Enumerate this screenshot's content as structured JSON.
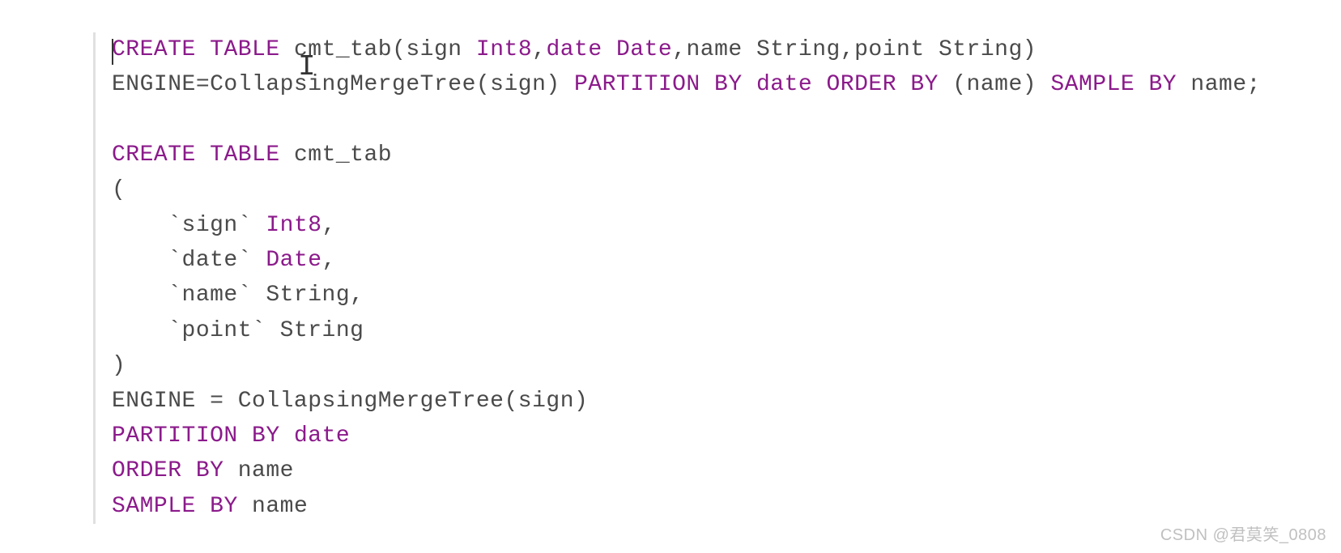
{
  "code": {
    "line1": {
      "kw_create": "CREATE",
      "kw_table": "TABLE",
      "name": " cmt_tab(sign ",
      "type_int8": "Int8",
      "comma1": ",",
      "kw_date": "date",
      "space1": " ",
      "type_date": "Date",
      "rest1": ",name String,point String)"
    },
    "line2": {
      "engine": "ENGINE=CollapsingMergeTree(sign) ",
      "kw_partition": "PARTITION",
      "space1": " ",
      "kw_by1": "BY",
      "space2": " ",
      "kw_date": "date",
      "space3": " ",
      "kw_order": "ORDER",
      "space4": " ",
      "kw_by2": "BY",
      "rest1": " (name) ",
      "kw_sample": "SAMPLE",
      "space5": " ",
      "kw_by3": "BY",
      "rest2": " name;"
    },
    "line4": {
      "kw_create": "CREATE",
      "space1": " ",
      "kw_table": "TABLE",
      "name": " cmt_tab"
    },
    "line5": {
      "paren": "("
    },
    "line6": {
      "text1": "    `sign` ",
      "type": "Int8",
      "text2": ","
    },
    "line7": {
      "text1": "    `date` ",
      "type": "Date",
      "text2": ","
    },
    "line8": {
      "text": "    `name` String,"
    },
    "line9": {
      "text": "    `point` String"
    },
    "line10": {
      "paren": ")"
    },
    "line11": {
      "text": "ENGINE = CollapsingMergeTree(sign)"
    },
    "line12": {
      "kw_partition": "PARTITION",
      "space1": " ",
      "kw_by": "BY",
      "space2": " ",
      "kw_date": "date"
    },
    "line13": {
      "kw_order": "ORDER",
      "space1": " ",
      "kw_by": "BY",
      "text": " name"
    },
    "line14": {
      "kw_sample": "SAMPLE",
      "space1": " ",
      "kw_by": "BY",
      "text": " name"
    }
  },
  "watermark": "CSDN @君莫笑_0808",
  "cursor_overlay": "I"
}
